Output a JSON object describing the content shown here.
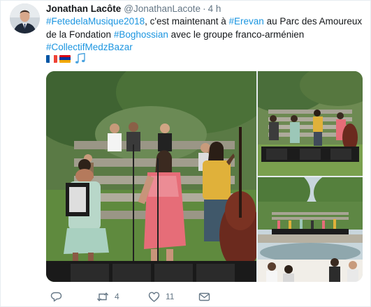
{
  "author": {
    "display_name": "Jonathan Lacôte",
    "handle": "@JonathanLacote",
    "separator": "·",
    "time": "4 h"
  },
  "tweet": {
    "tag_1": "#FetedelaMusique2018",
    "text_1": ", c'est maintenant à ",
    "tag_2": "#Erevan",
    "text_2": " au Parc des Amoureux de la Fondation ",
    "tag_3": "#Boghossian",
    "text_3": " avec le groupe franco-arménien ",
    "tag_4": "#CollectifMedzBazar",
    "emoji_names": [
      "france-flag-icon",
      "armenia-flag-icon",
      "musical-notes-icon"
    ]
  },
  "media": {
    "photos": [
      "photo-concert-singer",
      "photo-stage-wide",
      "photo-park-audience"
    ]
  },
  "actions": {
    "retweet_count": "4",
    "like_count": "11"
  },
  "colors": {
    "link": "#1b95e0",
    "secondary": "#657786",
    "text": "#14171a"
  }
}
